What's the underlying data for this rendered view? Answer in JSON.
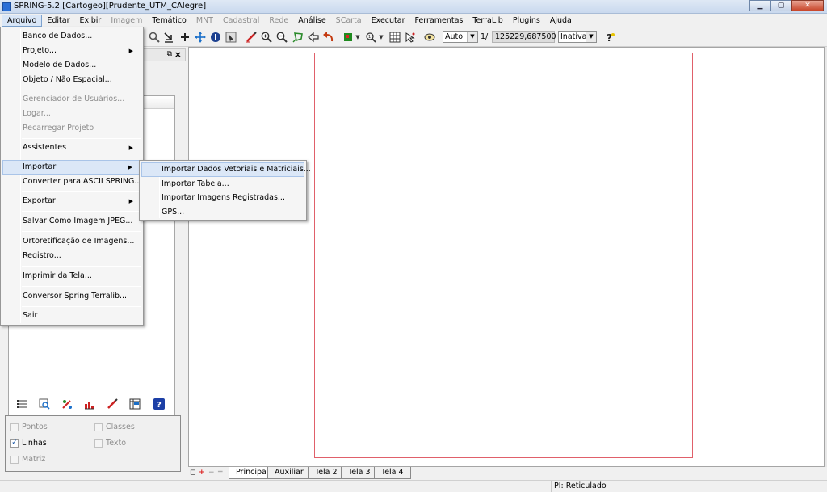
{
  "window": {
    "title": "SPRING-5.2 [Cartogeo][Prudente_UTM_CAlegre]",
    "minimize_label": "▁",
    "maximize_label": "▢",
    "close_label": "✕"
  },
  "menubar": {
    "items": [
      {
        "label": "Arquivo"
      },
      {
        "label": "Editar"
      },
      {
        "label": "Exibir"
      },
      {
        "label": "Imagem"
      },
      {
        "label": "Temático"
      },
      {
        "label": "MNT"
      },
      {
        "label": "Cadastral"
      },
      {
        "label": "Rede"
      },
      {
        "label": "Análise"
      },
      {
        "label": "SCarta"
      },
      {
        "label": "Executar"
      },
      {
        "label": "Ferramentas"
      },
      {
        "label": "TerraLib"
      },
      {
        "label": "Plugins"
      },
      {
        "label": "Ajuda"
      }
    ]
  },
  "toolbar": {
    "zoom_mode": "Auto",
    "scale_prefix": "1/",
    "scale_value": "125229,687500",
    "state": "Inativa"
  },
  "arquivo_menu": {
    "items": [
      {
        "label": "Banco de Dados..."
      },
      {
        "label": "Projeto..."
      },
      {
        "label": "Modelo de Dados..."
      },
      {
        "label": "Objeto / Não Espacial..."
      },
      {
        "label": "Gerenciador de Usuários..."
      },
      {
        "label": "Logar..."
      },
      {
        "label": "Recarregar Projeto"
      },
      {
        "label": "Assistentes"
      },
      {
        "label": "Importar"
      },
      {
        "label": "Converter para ASCII SPRING..."
      },
      {
        "label": "Exportar"
      },
      {
        "label": "Salvar Como Imagem JPEG..."
      },
      {
        "label": "Ortoretificação de Imagens..."
      },
      {
        "label": "Registro..."
      },
      {
        "label": "Imprimir da Tela..."
      },
      {
        "label": "Conversor Spring Terralib..."
      },
      {
        "label": "Sair"
      }
    ]
  },
  "importar_submenu": {
    "items": [
      {
        "label": "Importar Dados Vetoriais e Matriciais..."
      },
      {
        "label": "Importar Tabela..."
      },
      {
        "label": "Importar Imagens Registradas..."
      },
      {
        "label": "GPS..."
      }
    ]
  },
  "layers": {
    "pontos": "Pontos",
    "linhas": "Linhas",
    "matriz": "Matriz",
    "classes": "Classes",
    "texto": "Texto",
    "linhas_checked": true
  },
  "tabs": {
    "items": [
      {
        "label": "Principal"
      },
      {
        "label": "Auxiliar"
      },
      {
        "label": "Tela 2"
      },
      {
        "label": "Tela 3"
      },
      {
        "label": "Tela 4"
      }
    ]
  },
  "statusbar": {
    "pi": "PI: Reticulado"
  },
  "colors": {
    "frame": "#e0606a",
    "menu_highlight": "#dbe7f7"
  }
}
